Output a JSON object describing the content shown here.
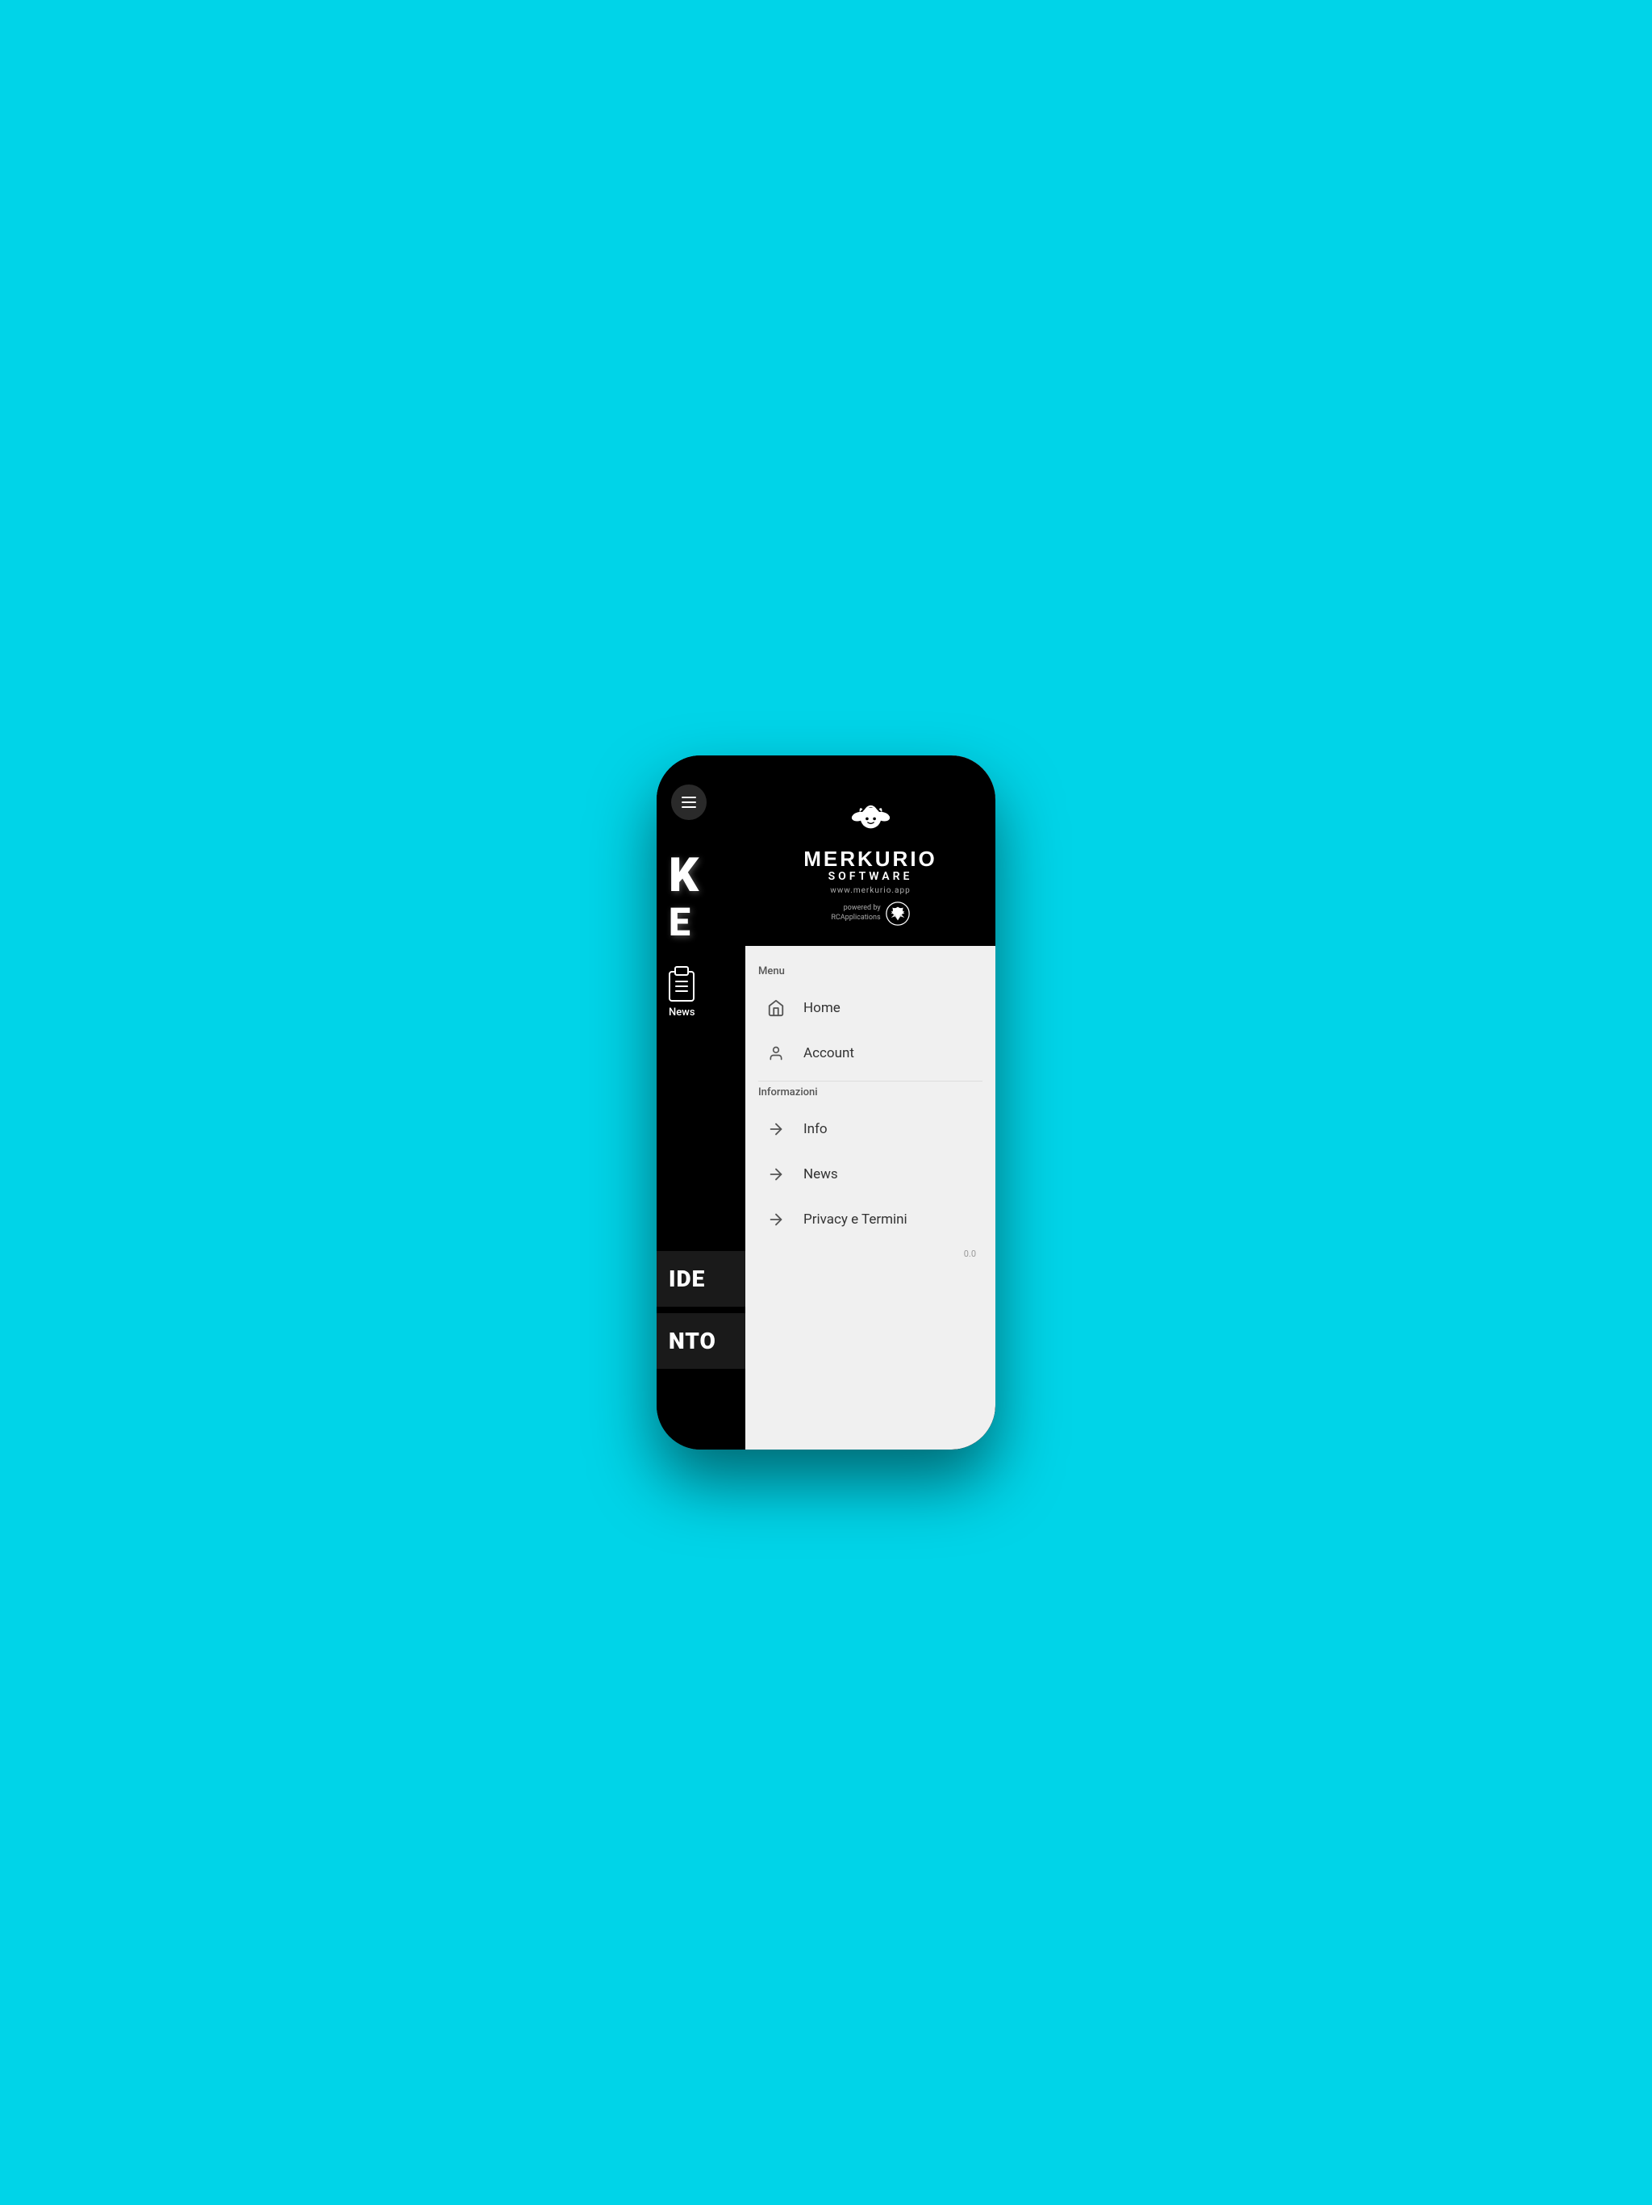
{
  "phone": {
    "background_color": "#00d4e8"
  },
  "app": {
    "left_content": {
      "text1": "K",
      "text2": "E",
      "news_label": "News",
      "box1": "IDE",
      "box2": "NTO"
    }
  },
  "header": {
    "logo_title": "MERKURIO",
    "logo_subtitle": "SOFTWARE",
    "logo_url": "www.merkurio.app",
    "powered_by_text": "powered by\nRCApplications"
  },
  "drawer": {
    "menu_section_label": "Menu",
    "informazioni_section_label": "Informazioni",
    "items": [
      {
        "id": "home",
        "label": "Home",
        "icon": "house",
        "type": "main"
      },
      {
        "id": "account",
        "label": "Account",
        "icon": "person",
        "type": "main"
      }
    ],
    "info_items": [
      {
        "id": "info",
        "label": "Info",
        "icon": "arrow",
        "type": "sub"
      },
      {
        "id": "news",
        "label": "News",
        "icon": "arrow",
        "type": "sub"
      },
      {
        "id": "privacy",
        "label": "Privacy e Termini",
        "icon": "arrow",
        "type": "sub"
      }
    ],
    "version": "0.0"
  },
  "hamburger": {
    "label": "menu-button"
  }
}
